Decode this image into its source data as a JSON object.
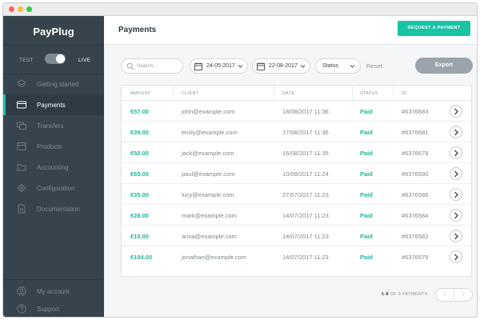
{
  "app": {
    "logo": "PayPlug"
  },
  "env": {
    "test_label": "TEST",
    "live_label": "LIVE"
  },
  "nav": [
    {
      "label": "Getting started",
      "icon": "layers-icon",
      "active": false
    },
    {
      "label": "Payments",
      "icon": "credit-card-icon",
      "active": true
    },
    {
      "label": "Transfers",
      "icon": "transfer-icon",
      "active": false
    },
    {
      "label": "Products",
      "icon": "box-icon",
      "active": false
    },
    {
      "label": "Accounting",
      "icon": "folder-icon",
      "active": false
    },
    {
      "label": "Configuration",
      "icon": "gear-icon",
      "active": false
    },
    {
      "label": "Documentation",
      "icon": "document-icon",
      "active": false
    }
  ],
  "nav_bottom": [
    {
      "label": "My account",
      "icon": "user-icon"
    },
    {
      "label": "Support",
      "icon": "help-icon"
    }
  ],
  "header": {
    "title": "Payments",
    "request_button": "REQUEST A PAYMENT"
  },
  "filters": {
    "search_placeholder": "Search...",
    "date_from": "24-05-2017",
    "date_to": "22-08-2017",
    "status": "Status",
    "reset": "Reset",
    "export": "Export"
  },
  "table": {
    "headers": {
      "amount": "AMOUNT",
      "client": "CLIENT",
      "date": "DATE",
      "status": "STATUS",
      "id": "ID"
    },
    "rows": [
      {
        "amount": "€57.00",
        "client": "john@example.com",
        "date": "18/08/2017 11:36",
        "status": "Paid",
        "id": "#6376683"
      },
      {
        "amount": "€39.00",
        "client": "emily@example.com",
        "date": "17/08/2017 11:36",
        "status": "Paid",
        "id": "#6376681"
      },
      {
        "amount": "€50.00",
        "client": "jack@example.com",
        "date": "16/08/2017 11:35",
        "status": "Paid",
        "id": "#6376678"
      },
      {
        "amount": "€65.00",
        "client": "paul@example.com",
        "date": "10/08/2017 11:24",
        "status": "Paid",
        "id": "#6376590"
      },
      {
        "amount": "€35.00",
        "client": "lucy@example.com",
        "date": "27/07/2017 11:23",
        "status": "Paid",
        "id": "#6376586"
      },
      {
        "amount": "€28.00",
        "client": "mark@example.com",
        "date": "14/07/2017 11:23",
        "status": "Paid",
        "id": "#6376584"
      },
      {
        "amount": "€10.00",
        "client": "anna@example.com",
        "date": "14/07/2017 11:23",
        "status": "Paid",
        "id": "#6376582"
      },
      {
        "amount": "€104.00",
        "client": "jonathan@example.com",
        "date": "14/07/2017 11:23",
        "status": "Paid",
        "id": "#6376579"
      }
    ]
  },
  "pagination": {
    "range": "1-8",
    "suffix": "OF 8 PAYMENTS",
    "prev": "‹",
    "next": "›"
  },
  "colors": {
    "accent": "#19c4a4",
    "sidebar": "#37444d",
    "export": "#9aa4aa"
  }
}
